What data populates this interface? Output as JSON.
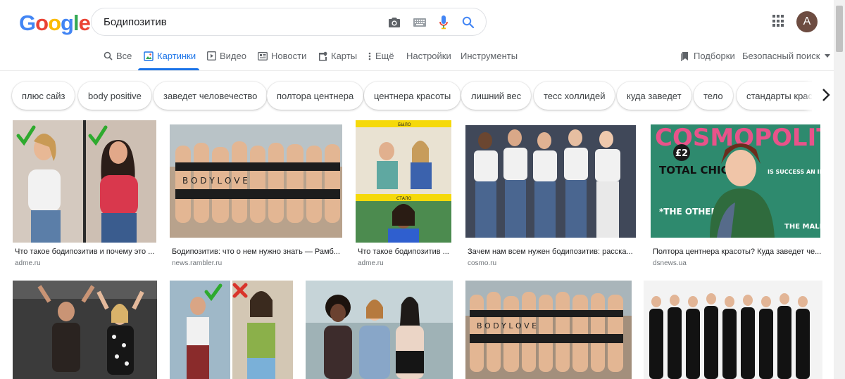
{
  "logo": {
    "letters": [
      "G",
      "o",
      "o",
      "g",
      "l",
      "e"
    ],
    "colors": [
      "#4285F4",
      "#EA4335",
      "#FBBC05",
      "#4285F4",
      "#34A853",
      "#EA4335"
    ]
  },
  "search": {
    "value": "Бодипозитив",
    "icons": [
      "camera-icon",
      "keyboard-icon",
      "microphone-icon",
      "search-icon"
    ]
  },
  "account": {
    "initial": "A"
  },
  "tabs": {
    "all": "Все",
    "images": "Картинки",
    "video": "Видео",
    "news": "Новости",
    "maps": "Карты",
    "more": "Ещё",
    "settings": "Настройки",
    "tools": "Инструменты",
    "collections": "Подборки",
    "safe_search": "Безопасный поиск"
  },
  "chips": [
    "плюс сайз",
    "body positive",
    "заведет человечество",
    "полтора центнера",
    "центнера красоты",
    "лишний вес",
    "тесс холлидей",
    "куда заведет",
    "тело",
    "стандарты красо"
  ],
  "results": [
    {
      "caption": "Что такое бодипозитив и почему это ...",
      "source": "adme.ru"
    },
    {
      "caption": "Бодипозитив: что о нем нужно знать — Рамб...",
      "source": "news.rambler.ru"
    },
    {
      "caption": "Что такое бодипозитив ...",
      "source": "adme.ru"
    },
    {
      "caption": "Зачем нам всем нужен бодипозитив: расска...",
      "source": "cosmo.ru"
    },
    {
      "caption": "Полтора центнера красоты? Куда заведет че...",
      "source": "dsnews.ua"
    }
  ],
  "image_text": {
    "body_love": "B O D Y   L O V E",
    "before_label": "БЫЛО",
    "after_label": "СТАЛО",
    "magazine_title": "COSMOPOLITAN",
    "magazine_price": "£2",
    "magazine_headline": "TOTAL CHIC",
    "magazine_side": "IS SUCCESS AN ILLNESS?",
    "magazine_other": "*THE OTHER LOVER",
    "magazine_male": "THE MALE"
  },
  "colors": {
    "accent": "#1a73e8",
    "text_secondary": "#5f6368",
    "check_green": "#2eaa2e",
    "cross_red": "#d9342b",
    "magazine_bg": "#2e8a6e",
    "yellow_bar": "#f5d90a"
  }
}
